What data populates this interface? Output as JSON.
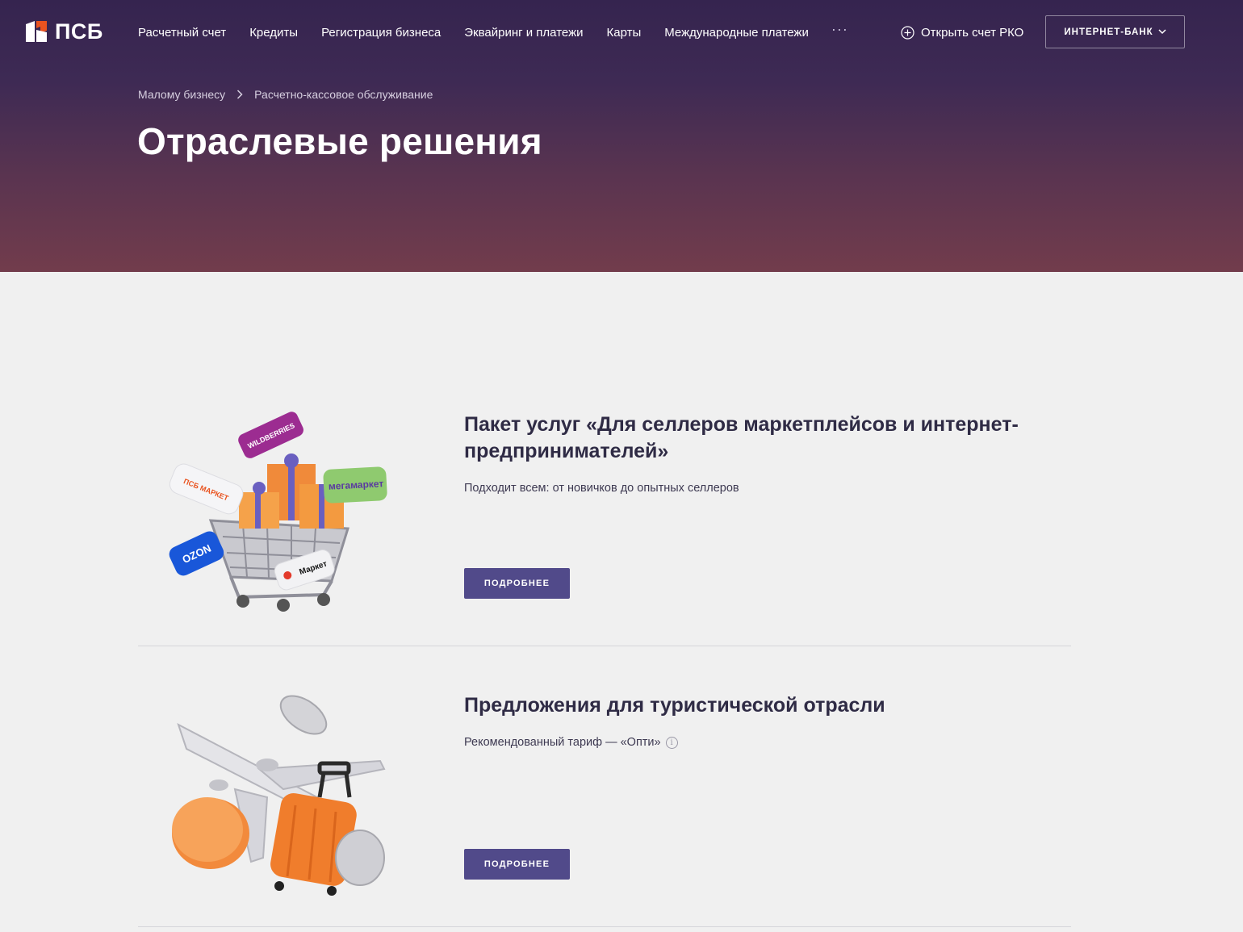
{
  "header": {
    "logo_text": "ПСБ",
    "nav": [
      "Расчетный счет",
      "Кредиты",
      "Регистрация бизнеса",
      "Эквайринг и платежи",
      "Карты",
      "Международные платежи"
    ],
    "more_label": "···",
    "open_account_label": "Открыть счет РКО",
    "internet_bank_label": "ИНТЕРНЕТ-БАНК"
  },
  "breadcrumb": [
    "Малому бизнесу",
    "Расчетно-кассовое обслуживание"
  ],
  "page_title": "Отраслевые решения",
  "cards": [
    {
      "title": "Пакет услуг «Для селлеров маркетплейсов и интернет-предпринимателей»",
      "description": "Подходит всем: от новичков до опытных селлеров",
      "button": "ПОДРОБНЕЕ",
      "image_labels": [
        "WILDBERRIES",
        "ПСБ МАРКЕТ",
        "мегамаркет",
        "OZON",
        "Маркет"
      ]
    },
    {
      "title": "Предложения для туристической отрасли",
      "description": "Рекомендованный тариф — «Опти»",
      "button": "ПОДРОБНЕЕ"
    }
  ],
  "colors": {
    "hero_top": "#35244f",
    "hero_bottom": "#723c4c",
    "accent_button": "#514a8a",
    "logo_orange": "#e9531f",
    "background": "#f0f0f0"
  }
}
